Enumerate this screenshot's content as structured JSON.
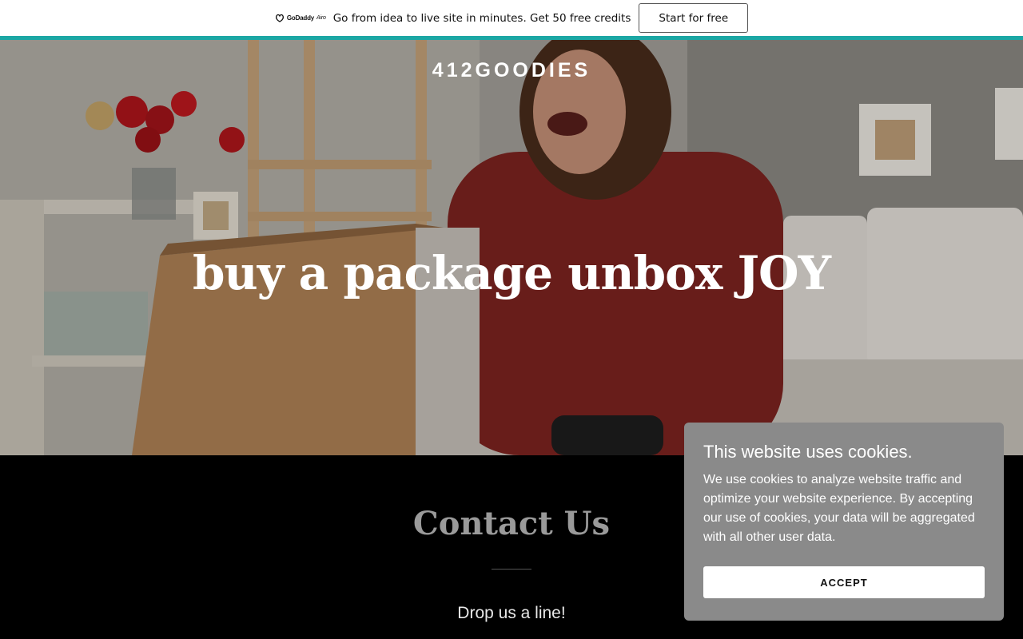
{
  "promo": {
    "logo_text": "GoDaddy",
    "logo_suffix": "Airo",
    "message": "Go from idea to live site in minutes. Get 50 free credits",
    "cta_label": "Start for free",
    "accent_color": "#1ba7a4"
  },
  "hero": {
    "site_title": "412GOODIES",
    "headline": "buy a package unbox JOY"
  },
  "contact": {
    "title": "Contact Us",
    "subtitle": "Drop us a line!"
  },
  "cookie": {
    "title": "This website uses cookies.",
    "body": "We use cookies to analyze website traffic and optimize your website experience. By accepting our use of cookies, your data will be aggregated with all other user data.",
    "accept_label": "ACCEPT"
  }
}
